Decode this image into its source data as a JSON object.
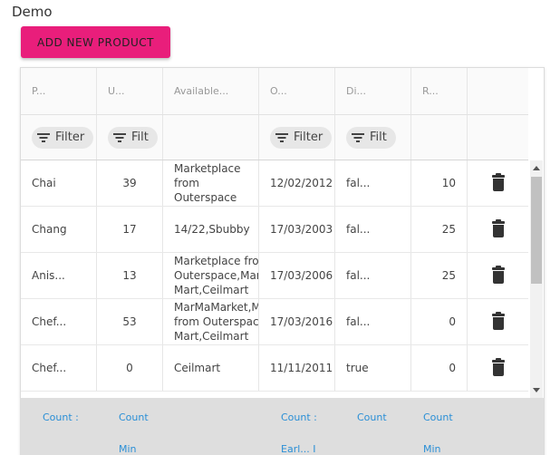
{
  "app": {
    "title": "Demo"
  },
  "toolbar": {
    "add_label": "ADD NEW PRODUCT"
  },
  "columns": [
    "P...",
    "U...",
    "Available...",
    "O...",
    "Di...",
    "R..."
  ],
  "filters": {
    "chip0": "Filter",
    "chip1": "Filt",
    "chip3": "Filter",
    "chip4": "Filt"
  },
  "rows": [
    {
      "name": "Chai",
      "units": "39",
      "available": "Marketplace from Outerspace",
      "date": "12/02/2012",
      "disc": "fal...",
      "reorder": "10"
    },
    {
      "name": "Chang",
      "units": "17",
      "available": "14/22,Sbubby",
      "date": "17/03/2003",
      "disc": "fal...",
      "reorder": "25"
    },
    {
      "name": "Anis...",
      "units": "13",
      "available": "Marketplace from Outerspace,Markt Mart,Ceilmart",
      "date": "17/03/2006",
      "disc": "fal...",
      "reorder": "25"
    },
    {
      "name": "Chef...",
      "units": "53",
      "available": "MarMaMarket,Marketplace from Outerspace,Markt Mart,Ceilmart",
      "date": "17/03/2016",
      "disc": "fal...",
      "reorder": "0"
    },
    {
      "name": "Chef...",
      "units": "0",
      "available": "Ceilmart",
      "date": "11/11/2011",
      "disc": "true",
      "reorder": "0"
    }
  ],
  "footer": {
    "c0_r1": "Count :",
    "c1_r1": "Count",
    "c1_r2": "Min",
    "c3_r1": "Count :",
    "c3_r2": "Earl... I",
    "c4_r1": "Count",
    "c5_r1": "Count",
    "c5_r2": "Min"
  },
  "icons": {
    "delete": "trash-icon",
    "filter": "filter-icon"
  },
  "colors": {
    "accent": "#e91e7b",
    "link": "#2a8fd6"
  }
}
